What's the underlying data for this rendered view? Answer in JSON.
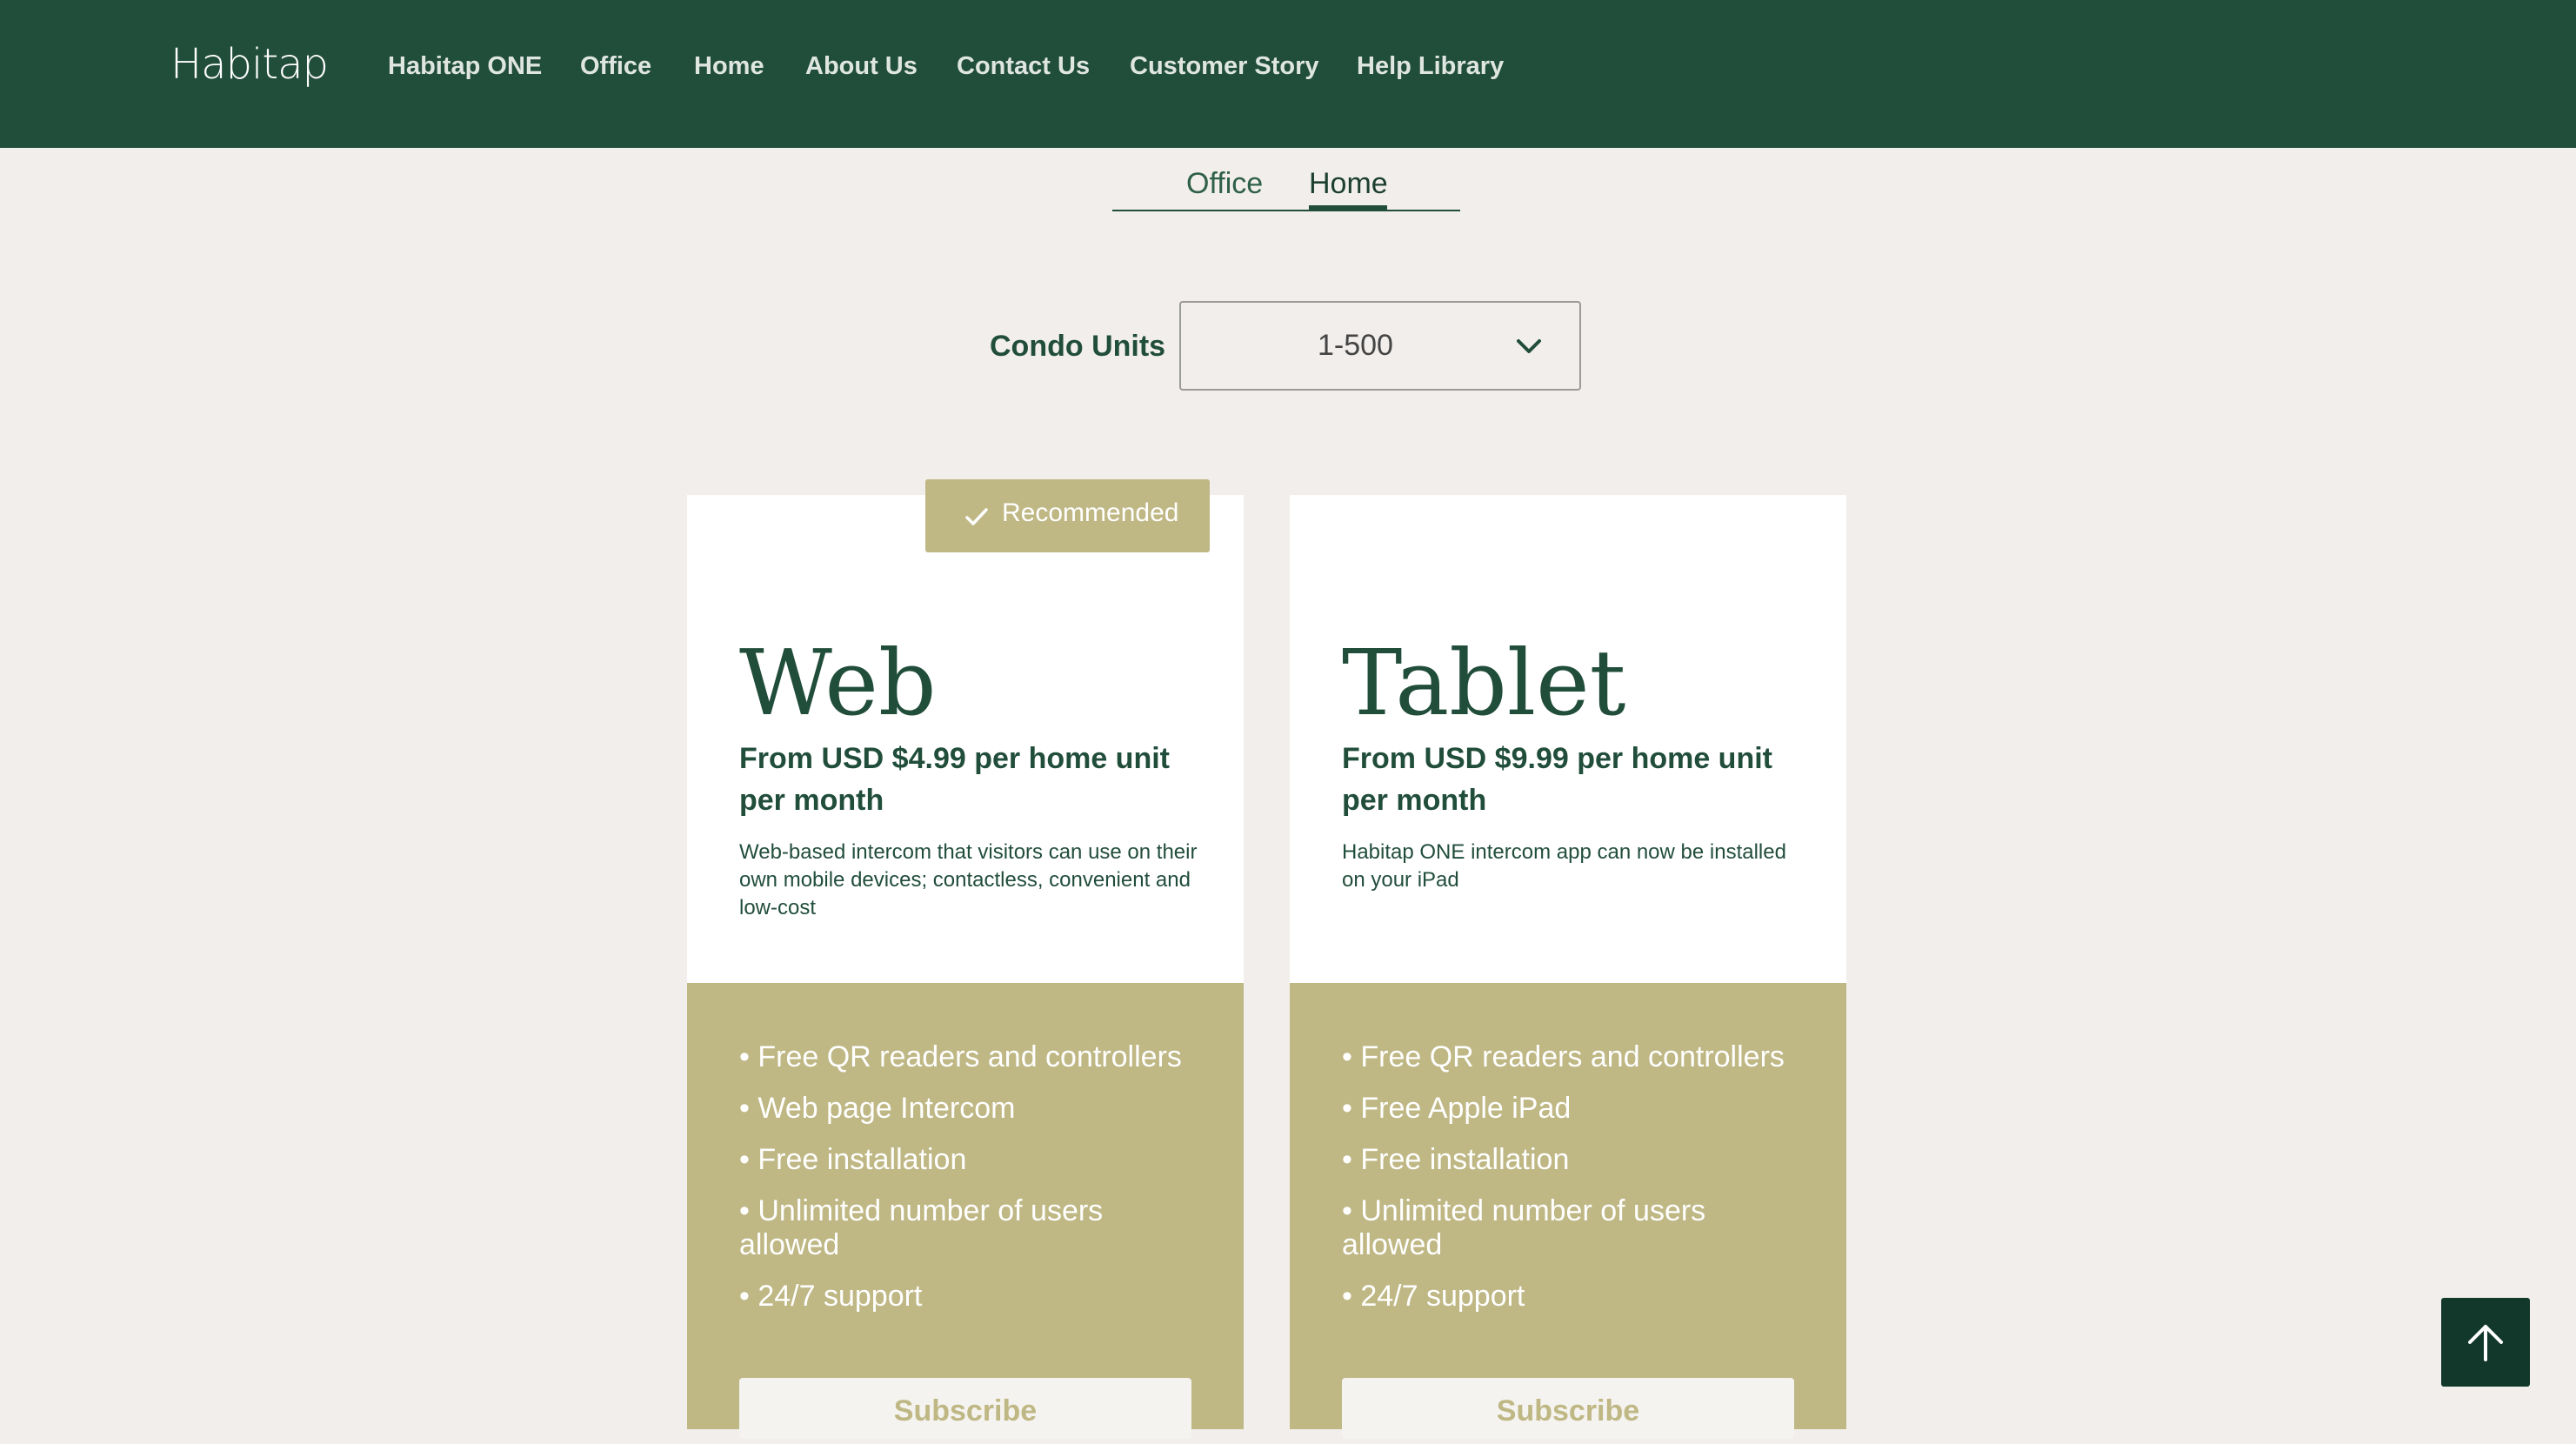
{
  "brand": {
    "logo_text": "Habitap"
  },
  "nav": {
    "items": [
      {
        "label": "Habitap ONE"
      },
      {
        "label": "Office"
      },
      {
        "label": "Home"
      },
      {
        "label": "About Us"
      },
      {
        "label": "Contact Us"
      },
      {
        "label": "Customer Story"
      },
      {
        "label": "Help Library"
      }
    ]
  },
  "tabs": {
    "items": [
      {
        "label": "Office",
        "active": false
      },
      {
        "label": "Home",
        "active": true
      }
    ]
  },
  "filter": {
    "label": "Condo Units",
    "selected": "1-500"
  },
  "plans": [
    {
      "name": "Web",
      "badge": "Recommended",
      "price": "From USD $4.99 per home unit per month",
      "description": "Web-based intercom that visitors can use on their own mobile devices; contactless, convenient and low-cost",
      "features": [
        "• Free QR readers and controllers",
        "• Web page Intercom",
        "• Free installation",
        "• Unlimited number of users allowed",
        "• 24/7 support"
      ],
      "cta": "Subscribe"
    },
    {
      "name": "Tablet",
      "price": "From USD $9.99 per home unit per month",
      "description": "Habitap ONE intercom app can now be installed on your iPad",
      "features": [
        "• Free QR readers and controllers",
        "• Free Apple iPad",
        "• Free installation",
        "• Unlimited number of users allowed",
        "• 24/7 support"
      ],
      "cta": "Subscribe"
    }
  ],
  "icons": {
    "chevron": "chevron-down-icon",
    "check": "check-icon",
    "back_to_top": "arrow-up-icon"
  },
  "colors": {
    "primary_green": "#214d3b",
    "olive": "#bfb784",
    "page_background": "#f1eeeb"
  }
}
